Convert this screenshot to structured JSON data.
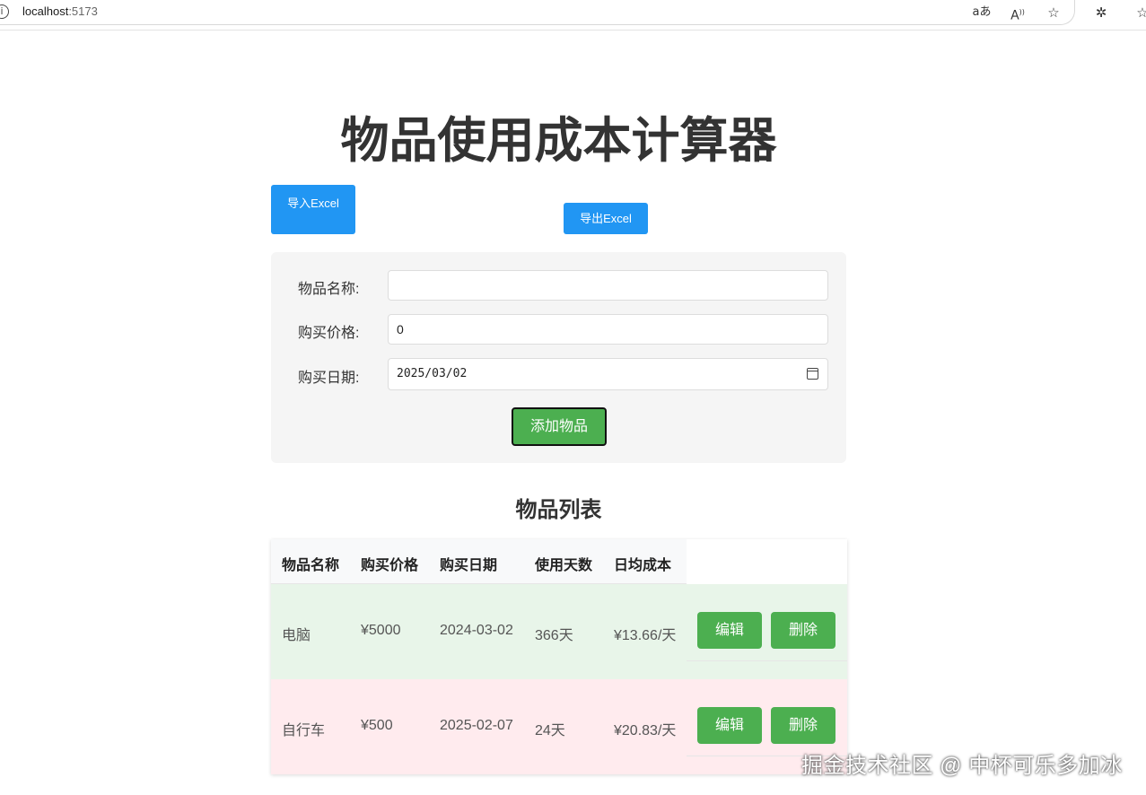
{
  "browser": {
    "url_host": "localhost",
    "url_port": ":5173",
    "icons": [
      "info-icon",
      "translate-icon",
      "read-aloud-icon",
      "favorite-star-icon",
      "extensions-icon",
      "favorites-icon"
    ]
  },
  "page": {
    "title": "物品使用成本计算器",
    "import_label": "导入Excel",
    "export_label": "导出Excel"
  },
  "form": {
    "name_label": "物品名称:",
    "name_value": "",
    "price_label": "购买价格:",
    "price_value": "0",
    "date_label": "购买日期:",
    "date_value": "2025/03/02",
    "add_label": "添加物品"
  },
  "list": {
    "title": "物品列表",
    "columns": [
      "物品名称",
      "购买价格",
      "购买日期",
      "使用天数",
      "日均成本"
    ],
    "rows": [
      {
        "name": "电脑",
        "price": "¥5000",
        "date": "2024-03-02",
        "days": "366天",
        "daily": "¥13.66/天",
        "edit": "编辑",
        "delete": "删除"
      },
      {
        "name": "自行车",
        "price": "¥500",
        "date": "2025-02-07",
        "days": "24天",
        "daily": "¥20.83/天",
        "edit": "编辑",
        "delete": "删除"
      }
    ],
    "row_colors": [
      "#e8f5e9",
      "#ffebee"
    ]
  },
  "colors": {
    "primary_blue": "#2196f3",
    "primary_green": "#4caf50"
  },
  "watermark": "掘金技术社区 @ 中杯可乐多加冰"
}
